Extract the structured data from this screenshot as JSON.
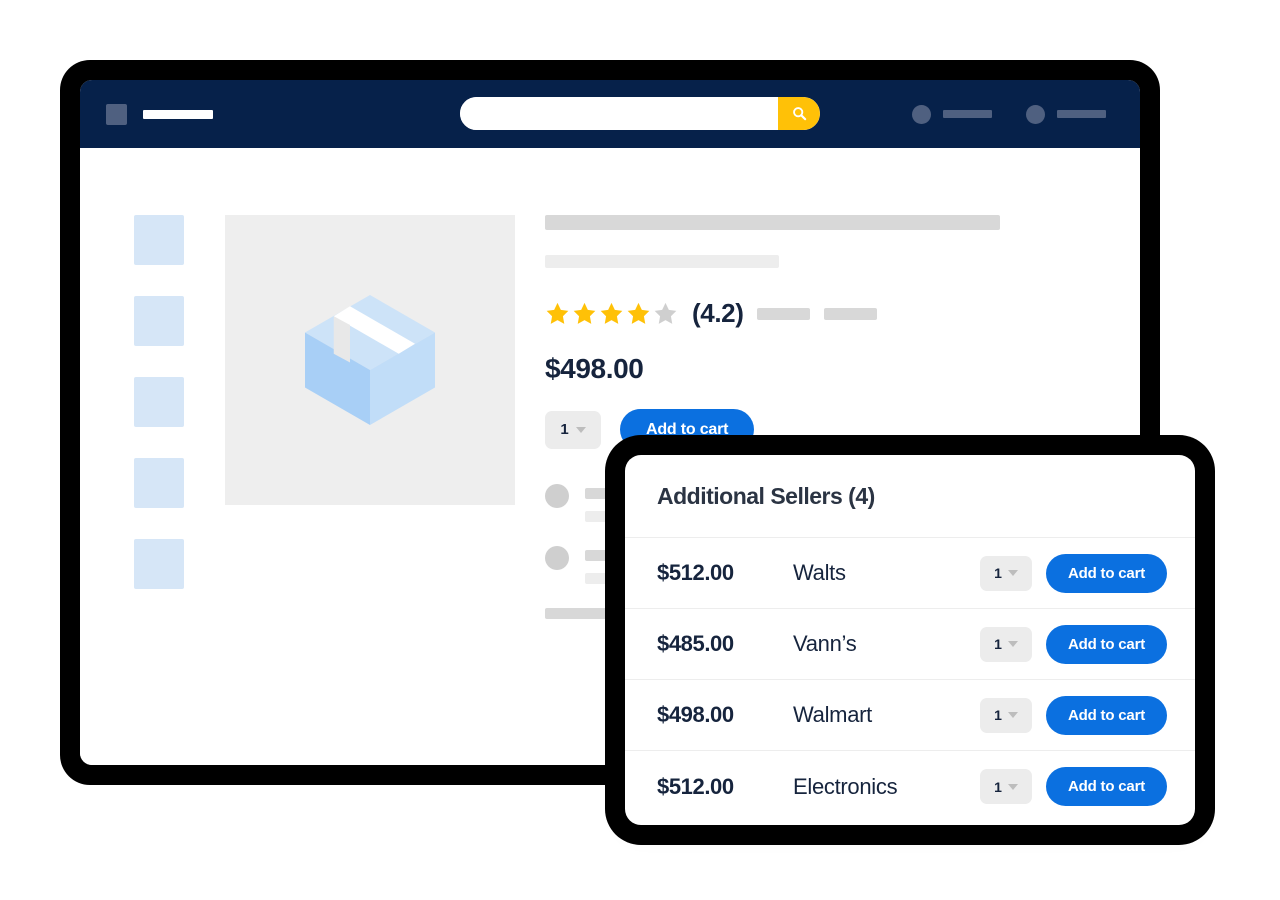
{
  "colors": {
    "navy_header": "#06214a",
    "accent_blue": "#0b70e0",
    "accent_yellow": "#ffc107",
    "star_filled": "#ffc107",
    "star_empty": "#cfcfcf",
    "text_dark": "#16243d",
    "thumb_blue": "#d6e6f7",
    "frame_black": "#000000"
  },
  "topbar": {
    "logo_icon": "logo-square-icon",
    "search": {
      "value": "",
      "placeholder": "",
      "button_icon": "search-icon"
    },
    "nav_items": [
      {
        "icon": "account-circle-icon",
        "label": ""
      },
      {
        "icon": "cart-circle-icon",
        "label": ""
      }
    ]
  },
  "gallery": {
    "thumbnail_count": 5,
    "hero_icon": "package-box-icon"
  },
  "product": {
    "title_placeholder": "",
    "subtitle_placeholder": "",
    "rating": {
      "stars_filled": 4,
      "stars_total": 5,
      "value_label": "(4.2)"
    },
    "price": "$498.00",
    "quantity": {
      "value": "1",
      "chevron_icon": "chevron-down-icon"
    },
    "add_to_cart_label": "Add to cart"
  },
  "placeholder_list": {
    "rows": 2,
    "tail_rows": 1
  },
  "sellers_popup": {
    "title": "Additional Sellers",
    "count_label": "(4)",
    "rows": [
      {
        "price": "$512.00",
        "seller": "Walts",
        "qty": "1",
        "add_to_cart_label": "Add to cart"
      },
      {
        "price": "$485.00",
        "seller": "Vann’s",
        "qty": "1",
        "add_to_cart_label": "Add to cart"
      },
      {
        "price": "$498.00",
        "seller": "Walmart",
        "qty": "1",
        "add_to_cart_label": "Add to cart"
      },
      {
        "price": "$512.00",
        "seller": "Electronics",
        "qty": "1",
        "add_to_cart_label": "Add to cart"
      }
    ]
  }
}
